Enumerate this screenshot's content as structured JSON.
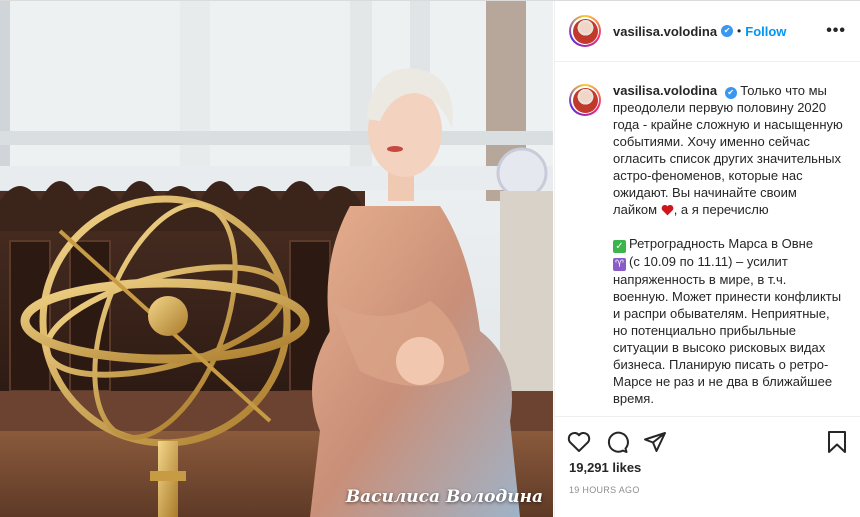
{
  "photo": {
    "watermark": "Василиса Володина"
  },
  "header": {
    "username": "vasilisa.volodina",
    "verified": true,
    "separator": "•",
    "follow_label": "Follow",
    "more_label": "•••"
  },
  "caption": {
    "username": "vasilisa.volodina",
    "intro": "Только что мы преодолели первую половину 2020 года - крайне сложную и насыщенную событиями. Хочу именно сейчас огласить список других значительных астро-феноменов, которые нас ожидают. Вы начинайте своим лайком",
    "intro_end": ", а я перечислю",
    "item1_title": "Ретроградность Марса в Овне",
    "item1_body": "(с 10.09 по 11.11) – усилит напряженность в мире, в т.ч. военную. Может принести конфликты и распри обывателям. Неприятные, но потенциально прибыльные ситуации в высоко рисковых видах бизнеса. Планирую писать о ретро-Марсе не раз и не два в ближайшее время."
  },
  "actions": {
    "like_icon": "heart-outline-icon",
    "comment_icon": "comment-icon",
    "share_icon": "paper-plane-icon",
    "save_icon": "bookmark-icon"
  },
  "likes_text": "19,291 likes",
  "timestamp": "19 HOURS AGO",
  "colors": {
    "link_blue": "#0095f6",
    "verified_blue": "#3897f0",
    "heart_red": "#d0161b",
    "check_green": "#3cb54a"
  }
}
